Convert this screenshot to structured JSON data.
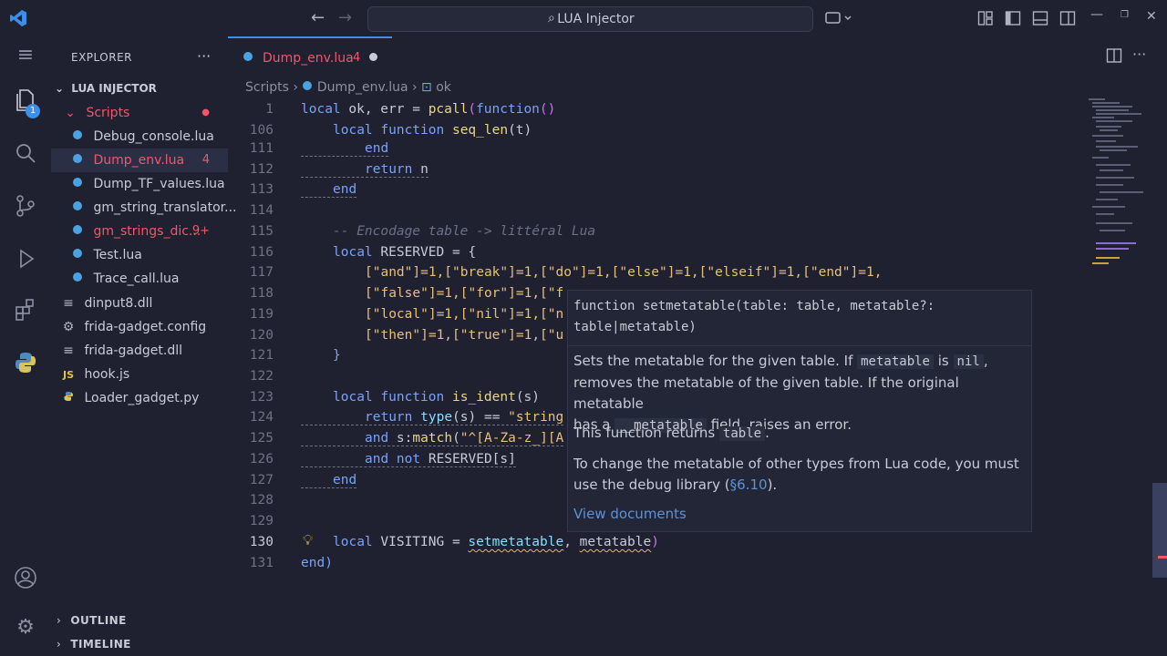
{
  "titlebar": {
    "command_center": "LUA Injector"
  },
  "explorer": {
    "header": "EXPLORER",
    "more": "···",
    "workspace": "LUA INJECTOR",
    "items": [
      {
        "label": "Scripts",
        "type": "folder",
        "badge": "●",
        "icon": "chevron-down-icon"
      },
      {
        "label": "Debug_console.lua",
        "type": "lua",
        "badge": ""
      },
      {
        "label": "Dump_env.lua",
        "type": "lua",
        "badge": "4"
      },
      {
        "label": "Dump_TF_values.lua",
        "type": "lua",
        "badge": ""
      },
      {
        "label": "gm_string_translator...",
        "type": "lua",
        "badge": ""
      },
      {
        "label": "gm_strings_dic...",
        "type": "lua",
        "badge": "9+"
      },
      {
        "label": "Test.lua",
        "type": "lua",
        "badge": ""
      },
      {
        "label": "Trace_call.lua",
        "type": "lua",
        "badge": ""
      },
      {
        "label": "dinput8.dll",
        "type": "dll",
        "badge": ""
      },
      {
        "label": "frida-gadget.config",
        "type": "config",
        "badge": ""
      },
      {
        "label": "frida-gadget.dll",
        "type": "dll",
        "badge": ""
      },
      {
        "label": "hook.js",
        "type": "js",
        "badge": "",
        "prefix": "JS"
      },
      {
        "label": "Loader_gadget.py",
        "type": "py",
        "badge": ""
      }
    ],
    "outline": "OUTLINE",
    "timeline": "TIMELINE"
  },
  "tab": {
    "label": "Dump_env.lua",
    "problems": "4"
  },
  "breadcrumb": {
    "folder": "Scripts",
    "file": "Dump_env.lua",
    "symbol": "ok"
  },
  "code_lines": [
    {
      "n": "1"
    },
    {
      "n": "106"
    },
    {
      "n": "111"
    },
    {
      "n": "112"
    },
    {
      "n": "113"
    },
    {
      "n": "114"
    },
    {
      "n": "115"
    },
    {
      "n": "116"
    },
    {
      "n": "117"
    },
    {
      "n": "118"
    },
    {
      "n": "119"
    },
    {
      "n": "120"
    },
    {
      "n": "121"
    },
    {
      "n": "122"
    },
    {
      "n": "123"
    },
    {
      "n": "124"
    },
    {
      "n": "125"
    },
    {
      "n": "126"
    },
    {
      "n": "127"
    },
    {
      "n": "128"
    },
    {
      "n": "129"
    },
    {
      "n": "130"
    },
    {
      "n": "131"
    }
  ],
  "code": {
    "l1": [
      "local",
      " ok, err = ",
      "pcall",
      "(",
      "function",
      "()"
    ],
    "l106": [
      "local",
      " function ",
      "seq_len",
      "(t)"
    ],
    "l111": "end",
    "l112": [
      "return",
      " n"
    ],
    "l113": "end",
    "l115": "-- Encodage table -> littéral Lua",
    "l116": [
      "local",
      " RESERVED = {"
    ],
    "l117": "[\"and\"]=1,[\"break\"]=1,[\"do\"]=1,[\"else\"]=1,[\"elseif\"]=1,[\"end\"]=1,",
    "l118": "[\"false\"]=1,[\"for\"]=1,[\"f",
    "l119": "[\"local\"]=1,[\"nil\"]=1,[\"n",
    "l120": "[\"then\"]=1,[\"true\"]=1,[\"u",
    "l121": "}",
    "l123": [
      "local",
      " function ",
      "is_ident",
      "(s)"
    ],
    "l124": [
      "return",
      " ",
      "type",
      "(s) == ",
      "\"string"
    ],
    "l125": [
      "and",
      " s:",
      "match",
      "(",
      "\"^[A-Za-z_][A"
    ],
    "l126": [
      "and not",
      " RESERVED[s]"
    ],
    "l127": "end",
    "l130": [
      "local",
      " VISITING = ",
      "setmetatable",
      ", ",
      "metatable",
      ")"
    ],
    "l131": "end)"
  },
  "hover": {
    "signature_1": "function setmetatable(table: table, metatable?:",
    "signature_2": "table|metatable)",
    "p1_a": "Sets the metatable for the given table. If ",
    "p1_code1": "metatable",
    "p1_b": " is ",
    "p1_code2": "nil",
    "p1_c": ",",
    "p1_d": "removes the metatable of the given table. If the original metatable",
    "p1_e": "has a ",
    "p1_code3": "__metatable",
    "p1_f": " field, raises an error.",
    "p2_a": "This function returns ",
    "p2_code": "table",
    "p2_b": ".",
    "p3_a": "To change the metatable of other types from Lua code, you must",
    "p3_b": "use the debug library (",
    "p3_link": "§6.10",
    "p3_c": ").",
    "link": "View documents"
  },
  "colors": {
    "accent": "#3b8eea",
    "error": "#f0576a",
    "background": "#1f2130"
  }
}
